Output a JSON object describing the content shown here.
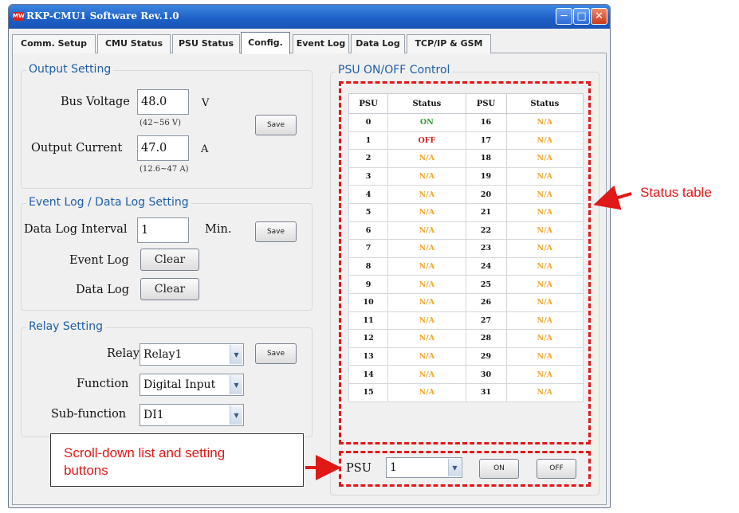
{
  "window": {
    "title": "RKP-CMU1 Software  Rev.1.0",
    "icon_text": "MW"
  },
  "tabs": [
    "Comm. Setup",
    "CMU Status",
    "PSU Status",
    "Config.",
    "Event Log",
    "Data Log",
    "TCP/IP & GSM"
  ],
  "output_setting": {
    "title": "Output Setting",
    "bus_voltage_label": "Bus Voltage",
    "bus_voltage_value": "48.0",
    "bus_voltage_unit": "V",
    "bus_voltage_range": "(42~56 V)",
    "output_current_label": "Output Current",
    "output_current_value": "47.0",
    "output_current_unit": "A",
    "output_current_range": "(12.6~47 A)",
    "save_label": "Save"
  },
  "log_setting": {
    "title": "Event Log / Data Log Setting",
    "interval_label": "Data Log Interval",
    "interval_value": "1",
    "interval_unit": "Min.",
    "save_label": "Save",
    "event_log_label": "Event Log",
    "data_log_label": "Data Log",
    "clear_label": "Clear"
  },
  "relay_setting": {
    "title": "Relay Setting",
    "relay_label": "Relay",
    "relay_value": "Relay1",
    "save_label": "Save",
    "function_label": "Function",
    "function_value": "Digital Input",
    "subfunction_label": "Sub-function",
    "subfunction_value": "DI1"
  },
  "psu_control": {
    "title": "PSU ON/OFF Control",
    "headers": [
      "PSU",
      "Status",
      "PSU",
      "Status"
    ],
    "rows": [
      [
        "0",
        "ON",
        "16",
        "N/A"
      ],
      [
        "1",
        "OFF",
        "17",
        "N/A"
      ],
      [
        "2",
        "N/A",
        "18",
        "N/A"
      ],
      [
        "3",
        "N/A",
        "19",
        "N/A"
      ],
      [
        "4",
        "N/A",
        "20",
        "N/A"
      ],
      [
        "5",
        "N/A",
        "21",
        "N/A"
      ],
      [
        "6",
        "N/A",
        "22",
        "N/A"
      ],
      [
        "7",
        "N/A",
        "23",
        "N/A"
      ],
      [
        "8",
        "N/A",
        "24",
        "N/A"
      ],
      [
        "9",
        "N/A",
        "25",
        "N/A"
      ],
      [
        "10",
        "N/A",
        "26",
        "N/A"
      ],
      [
        "11",
        "N/A",
        "27",
        "N/A"
      ],
      [
        "12",
        "N/A",
        "28",
        "N/A"
      ],
      [
        "13",
        "N/A",
        "29",
        "N/A"
      ],
      [
        "14",
        "N/A",
        "30",
        "N/A"
      ],
      [
        "15",
        "N/A",
        "31",
        "N/A"
      ]
    ],
    "psu_label": "PSU",
    "psu_value": "1",
    "on_label": "ON",
    "off_label": "OFF"
  },
  "status_colors": {
    "ON": "#2e9b2e",
    "OFF": "#e02020",
    "N/A": "#f0a830"
  },
  "annotations": {
    "status_table": "Status table",
    "scroll_down_line1": "Scroll-down list and setting",
    "scroll_down_line2": "buttons"
  }
}
